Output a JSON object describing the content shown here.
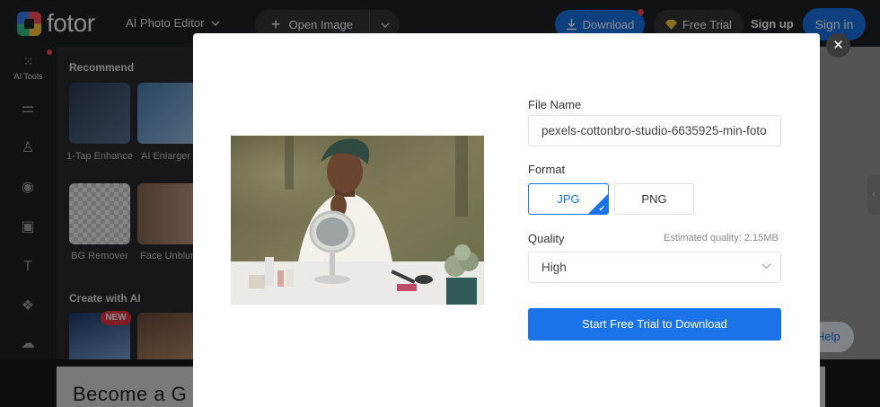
{
  "header": {
    "logo_text": "fotor",
    "editor_select": "AI Photo Editor",
    "open_image": "Open Image",
    "download": "Download",
    "free_trial": "Free Trial",
    "sign_up": "Sign up",
    "sign_in": "Sign in"
  },
  "sidebar": {
    "ai_tools_label": "AI Tools"
  },
  "panel": {
    "recommend_title": "Recommend",
    "tools": [
      {
        "label": "1-Tap Enhance"
      },
      {
        "label": "AI Enlarger"
      },
      {
        "label": "BG Remover"
      },
      {
        "label": "Face Unblur"
      }
    ],
    "create_title": "Create with AI",
    "new_badge": "NEW"
  },
  "canvas": {
    "help_label": "Help"
  },
  "banner": {
    "text": "Become a G"
  },
  "modal": {
    "file_name_label": "File Name",
    "file_name_value": "pexels-cottonbro-studio-6635925-min-foto",
    "format_label": "Format",
    "format_options": [
      "JPG",
      "PNG"
    ],
    "format_selected": "JPG",
    "quality_label": "Quality",
    "estimated_quality": "Estimated quality: 2.15MB",
    "quality_value": "High",
    "cta_label": "Start Free Trial to Download"
  },
  "colors": {
    "accent": "#1a73e8",
    "topbar_bg": "#202124",
    "badge_red": "#e8354a"
  }
}
